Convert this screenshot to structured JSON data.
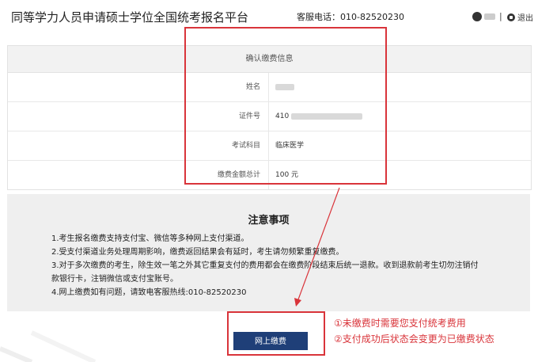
{
  "header": {
    "title": "同等学力人员申请硕士学位全国统考报名平台",
    "hotline": "客服电话：010-82520230",
    "logout_label": "退出"
  },
  "info": {
    "caption": "确认缴费信息",
    "rows": [
      {
        "label": "姓名",
        "value": ""
      },
      {
        "label": "证件号",
        "value": "410"
      },
      {
        "label": "考试科目",
        "value": "临床医学"
      },
      {
        "label": "缴费金额总计",
        "value": "100 元"
      }
    ]
  },
  "notice": {
    "title": "注意事项",
    "items": [
      "1.考生报名缴费支持支付宝、微信等多种网上支付渠道。",
      "2.受支付渠道业务处理周期影响，缴费返回结果会有延时，考生请勿频繁重复缴费。",
      "3.对于多次缴费的考生，除生效一笔之外其它重复支付的费用都会在缴费阶段结束后统一退款。收到退款前考生切勿注销付",
      "款银行卡，注销微信或支付宝账号。",
      "4.网上缴费如有问题，请致电客服热线:010-82520230"
    ]
  },
  "pay_button_label": "网上缴费",
  "annotations": {
    "line1": "①未缴费时需要您支付统考费用",
    "line2": "②支付成功后状态会变更为已缴费状态"
  },
  "colors": {
    "highlight": "#d9343a",
    "button": "#1f3f78",
    "amount": "#c0392b"
  }
}
